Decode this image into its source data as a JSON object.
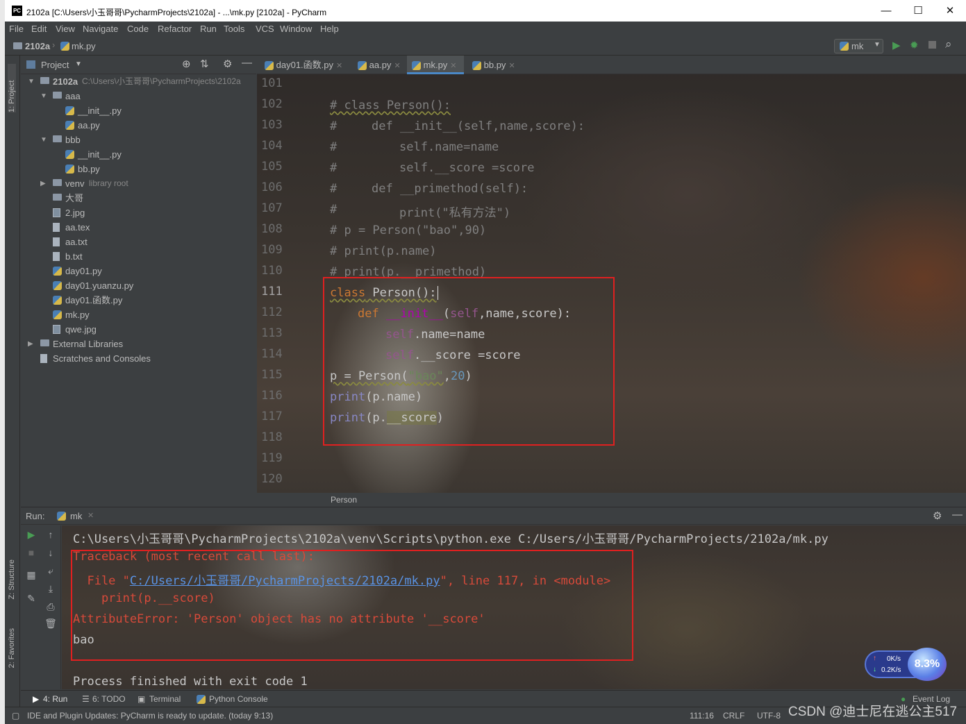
{
  "window": {
    "title": "2102a [C:\\Users\\小玉哥哥\\PycharmProjects\\2102a] - ...\\mk.py [2102a] - PyCharm",
    "app_icon": "PC",
    "minimize": "—",
    "maximize": "☐",
    "close": "✕"
  },
  "menu": [
    "File",
    "Edit",
    "View",
    "Navigate",
    "Code",
    "Refactor",
    "Run",
    "Tools",
    "VCS",
    "Window",
    "Help"
  ],
  "nav": {
    "project": "2102a",
    "file": "mk.py",
    "run_config": "mk"
  },
  "left_tool_windows": {
    "project": "1: Project",
    "structure": "Z: Structure",
    "favorites": "2: Favorites"
  },
  "project_panel": {
    "title": "Project",
    "tree": [
      {
        "label": "2102a",
        "path": "C:\\Users\\小玉哥哥\\PycharmProjects\\2102a",
        "icon": "folder-icon",
        "arrow": "▼",
        "level": 0
      },
      {
        "label": "aaa",
        "icon": "folder-icon",
        "arrow": "▼",
        "level": 1
      },
      {
        "label": "__init__.py",
        "icon": "python-file-icon",
        "level": 2
      },
      {
        "label": "aa.py",
        "icon": "python-file-icon",
        "level": 2
      },
      {
        "label": "bbb",
        "icon": "folder-icon",
        "arrow": "▼",
        "level": 1
      },
      {
        "label": "__init__.py",
        "icon": "python-file-icon",
        "level": 2
      },
      {
        "label": "bb.py",
        "icon": "python-file-icon",
        "level": 2
      },
      {
        "label": "venv",
        "suffix": "library root",
        "icon": "folder-icon",
        "arrow": "▶",
        "level": 1
      },
      {
        "label": "大哥",
        "icon": "folder-icon",
        "level": 1
      },
      {
        "label": "2.jpg",
        "icon": "image-file-icon",
        "level": 1
      },
      {
        "label": "aa.tex",
        "icon": "text-file-icon",
        "level": 1
      },
      {
        "label": "aa.txt",
        "icon": "text-file-icon",
        "level": 1
      },
      {
        "label": "b.txt",
        "icon": "text-file-icon",
        "level": 1
      },
      {
        "label": "day01.py",
        "icon": "python-file-icon",
        "level": 1
      },
      {
        "label": "day01.yuanzu.py",
        "icon": "python-file-icon",
        "level": 1
      },
      {
        "label": "day01.函数.py",
        "icon": "python-file-icon",
        "level": 1
      },
      {
        "label": "mk.py",
        "icon": "python-file-icon",
        "level": 1
      },
      {
        "label": "qwe.jpg",
        "icon": "image-file-icon",
        "level": 1
      },
      {
        "label": "External Libraries",
        "icon": "libraries-icon",
        "arrow": "▶",
        "level": 0
      },
      {
        "label": "Scratches and Consoles",
        "icon": "scratches-icon",
        "level": 0
      }
    ]
  },
  "editor": {
    "tabs": [
      {
        "label": "day01.函数.py",
        "active": false
      },
      {
        "label": "aa.py",
        "active": false
      },
      {
        "label": "mk.py",
        "active": true
      },
      {
        "label": "bb.py",
        "active": false
      }
    ],
    "line_numbers": [
      "101",
      "102",
      "103",
      "104",
      "105",
      "106",
      "107",
      "108",
      "109",
      "110",
      "111",
      "112",
      "113",
      "114",
      "115",
      "116",
      "117",
      "118",
      "119",
      "120"
    ],
    "current_line": "111",
    "code": {
      "l102": "# class Person():",
      "l103_a": "#",
      "l103_b": "def __init__(self,name,score):",
      "l104_a": "#",
      "l104_b": "self.name=name",
      "l105_a": "#",
      "l105_b": "self.__score =score",
      "l106_a": "#",
      "l106_b": "def __primethod(self):",
      "l107_a": "#",
      "l107_b": "print(\"私有方法\")",
      "l108": "# p = Person(\"bao\",90)",
      "l109": "# print(p.name)",
      "l110": "# print(p.__primethod)",
      "l111_kw": "class",
      "l111_rest": " Person():",
      "l112_kw": "def",
      "l112_fn": "__init__",
      "l112_p1": "(",
      "l112_self": "self",
      "l112_rest": ",name,score):",
      "l113_self": "self",
      "l113_rest": ".name=name",
      "l114_self": "self",
      "l114_rest": ".__score =score",
      "l115_a": "p = Person(",
      "l115_str": "\"bao\"",
      "l115_comma": ",",
      "l115_num": "20",
      "l115_end": ")",
      "l116_print": "print",
      "l116_rest": "(p.name)",
      "l117_print": "print",
      "l117_p": "(p.",
      "l117_hl": "__score",
      "l117_end": ")"
    },
    "breadcrumb": "Person"
  },
  "run_panel": {
    "label": "Run:",
    "tab": "mk",
    "output": {
      "cmd": "C:\\Users\\小玉哥哥\\PycharmProjects\\2102a\\venv\\Scripts\\python.exe C:/Users/小玉哥哥/PycharmProjects/2102a/mk.py",
      "tb1": "Traceback (most recent call last):",
      "tb2_a": "  File \"",
      "tb2_link": "C:/Users/小玉哥哥/PycharmProjects/2102a/mk.py",
      "tb2_b": "\", line 117, in <module>",
      "tb3": "    print(p.__score)",
      "tb4": "AttributeError: 'Person' object has no attribute '__score'",
      "out": "bao",
      "exit": "Process finished with exit code 1"
    }
  },
  "net_widget": {
    "up": "0K/s",
    "down": "0.2K/s",
    "percent": "8.3%"
  },
  "bottom_tools": {
    "run": "4: Run",
    "todo": "6: TODO",
    "terminal": "Terminal",
    "python_console": "Python Console",
    "event_log": "Event Log"
  },
  "status": {
    "message": "IDE and Plugin Updates: PyCharm is ready to update. (today 9:13)",
    "position": "111:16",
    "line_sep": "CRLF",
    "encoding": "UTF-8"
  },
  "watermark": "CSDN @迪士尼在逃公主517"
}
